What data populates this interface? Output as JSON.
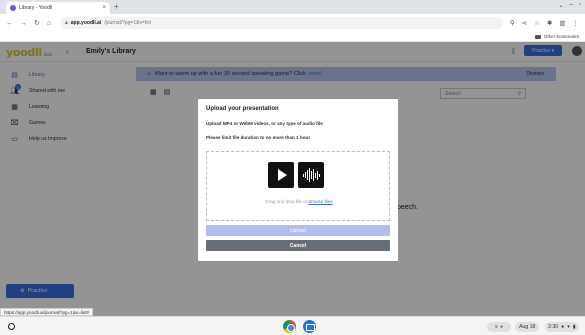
{
  "browser": {
    "tab_title": "Library - Yoodli",
    "url_domain": "app.yoodli.ai",
    "url_path": "/journal/?pg=1&v=list",
    "bookmarks_other": "Other bookmarks"
  },
  "app": {
    "logo": "yoodli",
    "logo_sub": "Beta",
    "page_title": "Emily's Library",
    "practice_top": "Practice ▾"
  },
  "sidebar": {
    "items": [
      {
        "label": "Library"
      },
      {
        "label": "Shared with me",
        "badge": "1"
      },
      {
        "label": "Learning"
      },
      {
        "label": "Games"
      },
      {
        "label": "Help us Improve"
      }
    ],
    "practice_label": "Practice"
  },
  "main": {
    "banner_text": "Want to warm up with a fun 30 second speaking game? Click",
    "banner_link": "here!",
    "banner_dismiss": "Dismiss",
    "search_placeholder": "Search",
    "bg_text": "peech."
  },
  "modal": {
    "title": "Upload your presentation",
    "line1": "Upload MP4 or WebM videos, or any type of audio file",
    "line2": "Please limit file duration to no more than 1 hour",
    "dz_text": "Drag and drop file or",
    "dz_link": "browse files",
    "upload_label": "Upload",
    "cancel_label": "Cancel"
  },
  "status_url": "https://app.yoodli.ai/journal/?pg=1&v=list#",
  "taskbar": {
    "date": "Aug 18",
    "time": "2:30"
  }
}
